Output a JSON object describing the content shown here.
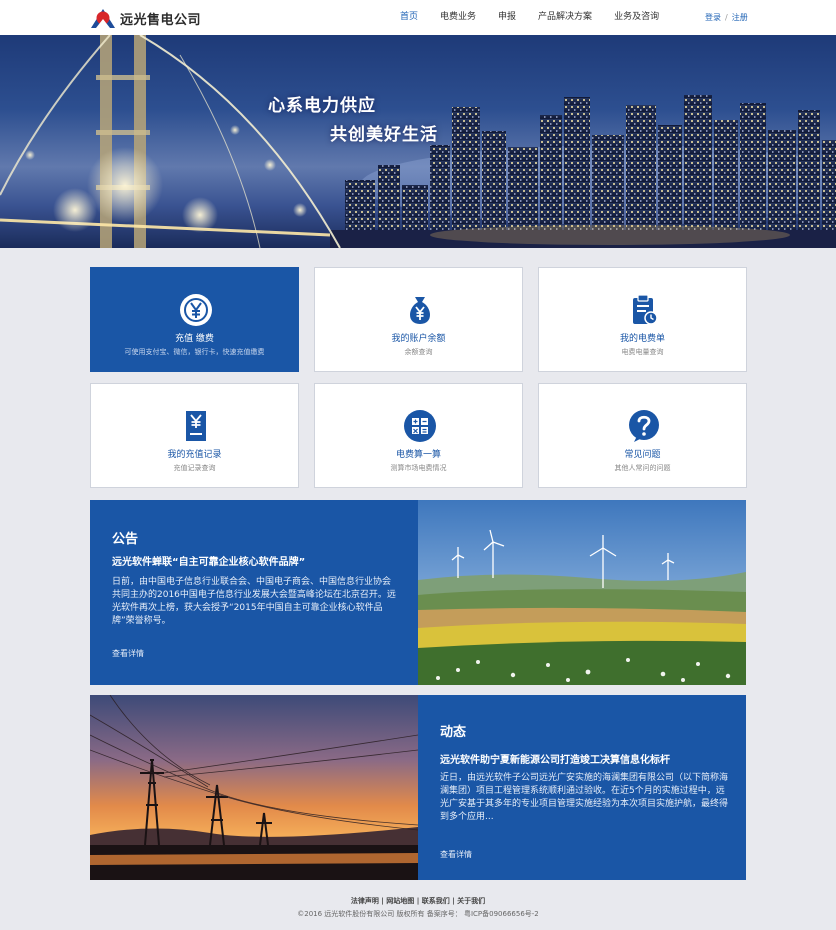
{
  "header": {
    "logo_text": "远光售电公司",
    "nav": [
      "首页",
      "电费业务",
      "申报",
      "产品解决方案",
      "业务及咨询"
    ],
    "login": "登录",
    "separator": "/",
    "register": "注册",
    "accent_color": "#1e62b4"
  },
  "hero": {
    "line1": "心系电力供应",
    "line2": "共创美好生活"
  },
  "cards": [
    {
      "title": "充值 缴费",
      "subtitle": "可使用支付宝、微信，银行卡，快速充值缴费",
      "icon": "yen-coin-icon"
    },
    {
      "title": "我的账户余额",
      "subtitle": "余额查询",
      "icon": "money-bag-icon"
    },
    {
      "title": "我的电费单",
      "subtitle": "电费电量查询",
      "icon": "clipboard-bill-icon"
    },
    {
      "title": "我的充值记录",
      "subtitle": "充值记录查询",
      "icon": "receipt-icon"
    },
    {
      "title": "电费算一算",
      "subtitle": "测算市场电费情况",
      "icon": "calculator-icon"
    },
    {
      "title": "常见问题",
      "subtitle": "其他人常问的问题",
      "icon": "question-icon"
    }
  ],
  "notice": {
    "heading": "公告",
    "title": "远光软件蝉联“自主可靠企业核心软件品牌”",
    "body": "日前，由中国电子信息行业联合会、中国电子商会、中国信息行业协会共同主办的2016中国电子信息行业发展大会暨高峰论坛在北京召开。远光软件再次上榜，获大会授予“2015年中国自主可靠企业核心软件品牌”荣誉称号。",
    "more": "查看详情"
  },
  "news": {
    "heading": "动态",
    "title": "远光软件助宁夏新能源公司打造竣工决算信息化标杆",
    "body": "近日，由远光软件子公司远光广安实施的海澜集团有限公司（以下简称海澜集团）项目工程管理系统顺利通过验收。在近5个月的实施过程中，远光广安基于其多年的专业项目管理实施经验为本次项目实施护航，最终得到多个应用...",
    "more": "查看详情"
  },
  "footer": {
    "links": [
      "法律声明",
      "网站地图",
      "联系我们",
      "关于我们"
    ],
    "copyright": "©2016 远光软件股份有限公司 版权所有 备案序号： 粤ICP备09066656号-2"
  },
  "colors": {
    "primary_blue": "#1a56a6",
    "page_bg": "#e8e9ee"
  }
}
